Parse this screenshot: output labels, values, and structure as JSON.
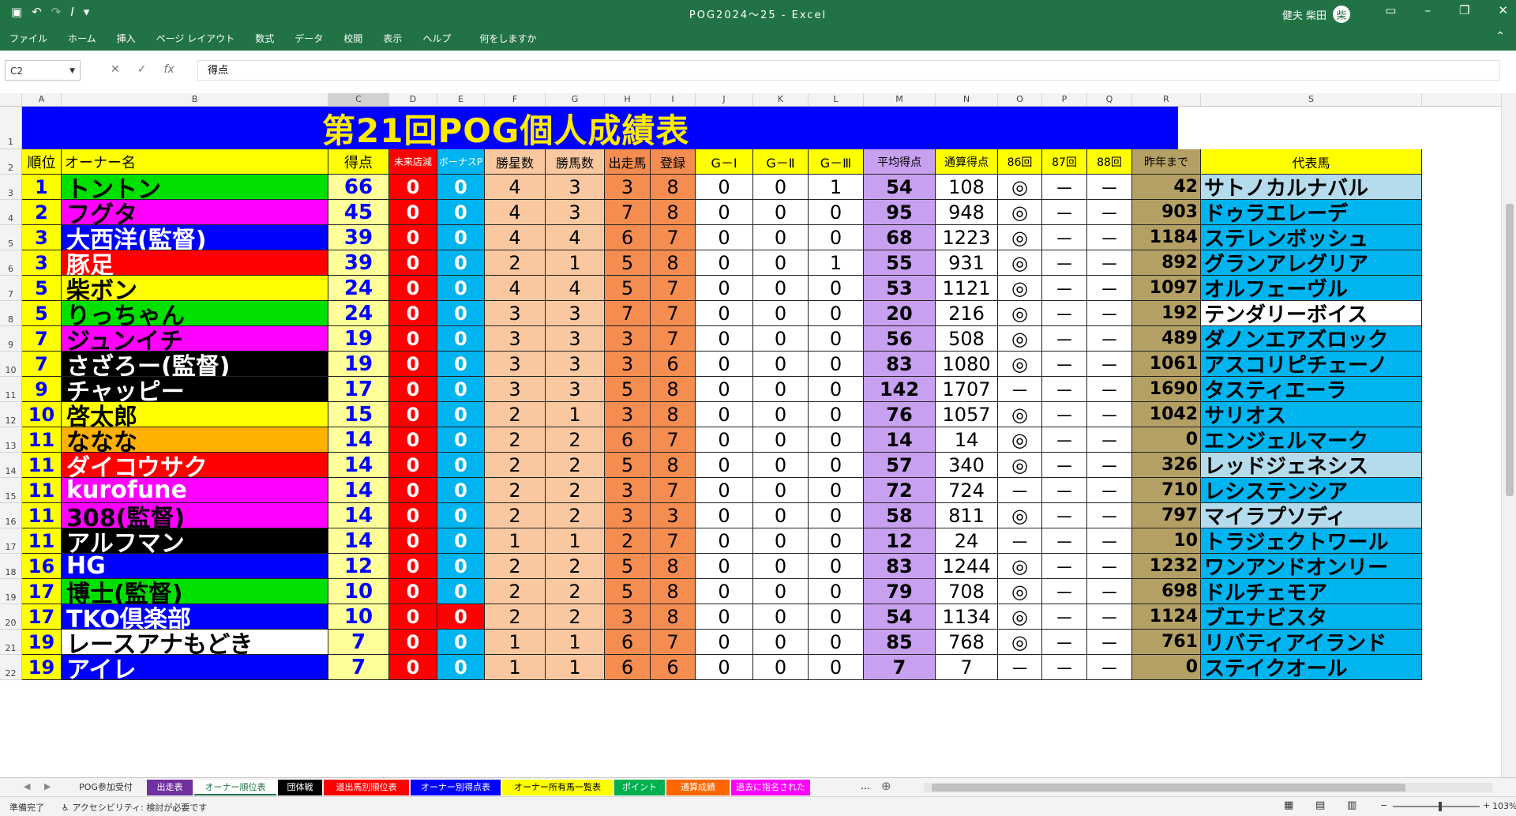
{
  "window": {
    "title": "POG2024～25 - Excel",
    "user": "健夫 柴田",
    "user_initial": "柴"
  },
  "qat": {
    "save_icon": "save-icon",
    "undo": "↶",
    "redo": "↷",
    "italic": "I"
  },
  "ribbon_tabs": [
    "ファイル",
    "ホーム",
    "挿入",
    "ページ レイアウト",
    "数式",
    "データ",
    "校閲",
    "表示",
    "ヘルプ",
    "何をしますか"
  ],
  "formula_bar": {
    "name_box": "C2",
    "formula": "得点"
  },
  "column_letters": [
    "A",
    "B",
    "C",
    "D",
    "E",
    "F",
    "G",
    "H",
    "I",
    "J",
    "K",
    "L",
    "M",
    "N",
    "O",
    "P",
    "Q",
    "R",
    "S"
  ],
  "sheet_title": "第21回POG個人成績表",
  "headers": [
    "順位",
    "オーナー名",
    "得点",
    "未来店減",
    "ボーナスP",
    "勝星数",
    "勝馬数",
    "出走馬",
    "登録",
    "G－Ⅰ",
    "G－Ⅱ",
    "G－Ⅲ",
    "平均得点",
    "通算得点",
    "86回",
    "87回",
    "88回",
    "昨年まで",
    "代表馬"
  ],
  "row_numbers": [
    "1",
    "2",
    "3",
    "4",
    "5",
    "6",
    "7",
    "8",
    "9",
    "10",
    "11",
    "12",
    "13",
    "14",
    "15",
    "16",
    "17",
    "18",
    "19",
    "20",
    "21",
    "22"
  ],
  "rows": [
    [
      "1",
      "トントン",
      "66",
      "0",
      "0",
      "4",
      "3",
      "3",
      "8",
      "0",
      "0",
      "1",
      "54",
      "108",
      "◎",
      "－",
      "－",
      "42",
      "サトノカルナバル"
    ],
    [
      "2",
      "フグタ",
      "45",
      "0",
      "0",
      "4",
      "3",
      "7",
      "8",
      "0",
      "0",
      "0",
      "95",
      "948",
      "◎",
      "－",
      "－",
      "903",
      "ドゥラエレーデ"
    ],
    [
      "3",
      "大西洋(監督)",
      "39",
      "0",
      "0",
      "4",
      "4",
      "6",
      "7",
      "0",
      "0",
      "0",
      "68",
      "1223",
      "◎",
      "－",
      "－",
      "1184",
      "ステレンボッシュ"
    ],
    [
      "3",
      "豚足",
      "39",
      "0",
      "0",
      "2",
      "1",
      "5",
      "8",
      "0",
      "0",
      "1",
      "55",
      "931",
      "◎",
      "－",
      "－",
      "892",
      "グランアレグリア"
    ],
    [
      "5",
      "柴ボン",
      "24",
      "0",
      "0",
      "4",
      "4",
      "5",
      "7",
      "0",
      "0",
      "0",
      "53",
      "1121",
      "◎",
      "－",
      "－",
      "1097",
      "オルフェーヴル"
    ],
    [
      "5",
      "りっちゃん",
      "24",
      "0",
      "0",
      "3",
      "3",
      "7",
      "7",
      "0",
      "0",
      "0",
      "20",
      "216",
      "◎",
      "－",
      "－",
      "192",
      "テンダリーボイス"
    ],
    [
      "7",
      "ジュンイチ",
      "19",
      "0",
      "0",
      "3",
      "3",
      "3",
      "7",
      "0",
      "0",
      "0",
      "56",
      "508",
      "◎",
      "－",
      "－",
      "489",
      "ダノンエアズロック"
    ],
    [
      "7",
      "さざろー(監督)",
      "19",
      "0",
      "0",
      "3",
      "3",
      "3",
      "6",
      "0",
      "0",
      "0",
      "83",
      "1080",
      "◎",
      "－",
      "－",
      "1061",
      "アスコリピチェーノ"
    ],
    [
      "9",
      "チャッピー",
      "17",
      "0",
      "0",
      "3",
      "3",
      "5",
      "8",
      "0",
      "0",
      "0",
      "142",
      "1707",
      "－",
      "－",
      "－",
      "1690",
      "タスティエーラ"
    ],
    [
      "10",
      "啓太郎",
      "15",
      "0",
      "0",
      "2",
      "1",
      "3",
      "8",
      "0",
      "0",
      "0",
      "76",
      "1057",
      "◎",
      "－",
      "－",
      "1042",
      "サリオス"
    ],
    [
      "11",
      "ななな",
      "14",
      "0",
      "0",
      "2",
      "2",
      "6",
      "7",
      "0",
      "0",
      "0",
      "14",
      "14",
      "◎",
      "－",
      "－",
      "0",
      "エンジェルマーク"
    ],
    [
      "11",
      "ダイコウサク",
      "14",
      "0",
      "0",
      "2",
      "2",
      "5",
      "8",
      "0",
      "0",
      "0",
      "57",
      "340",
      "◎",
      "－",
      "－",
      "326",
      "レッドジェネシス"
    ],
    [
      "11",
      "kurofune",
      "14",
      "0",
      "0",
      "2",
      "2",
      "3",
      "7",
      "0",
      "0",
      "0",
      "72",
      "724",
      "－",
      "－",
      "－",
      "710",
      "レシステンシア"
    ],
    [
      "11",
      "308(監督)",
      "14",
      "0",
      "0",
      "2",
      "2",
      "3",
      "3",
      "0",
      "0",
      "0",
      "58",
      "811",
      "◎",
      "－",
      "－",
      "797",
      "マイラプソディ"
    ],
    [
      "11",
      "アルフマン",
      "14",
      "0",
      "0",
      "1",
      "1",
      "2",
      "7",
      "0",
      "0",
      "0",
      "12",
      "24",
      "－",
      "－",
      "－",
      "10",
      "トラジェクトワール"
    ],
    [
      "16",
      "HG",
      "12",
      "0",
      "0",
      "2",
      "2",
      "5",
      "8",
      "0",
      "0",
      "0",
      "83",
      "1244",
      "◎",
      "－",
      "－",
      "1232",
      "ワンアンドオンリー"
    ],
    [
      "17",
      "博士(監督)",
      "10",
      "0",
      "0",
      "2",
      "2",
      "5",
      "8",
      "0",
      "0",
      "0",
      "79",
      "708",
      "◎",
      "－",
      "－",
      "698",
      "ドルチェモア"
    ],
    [
      "17",
      "TKO倶楽部",
      "10",
      "0",
      "0",
      "2",
      "2",
      "3",
      "8",
      "0",
      "0",
      "0",
      "54",
      "1134",
      "◎",
      "－",
      "－",
      "1124",
      "ブエナビスタ"
    ],
    [
      "19",
      "レースアナもどき",
      "7",
      "0",
      "0",
      "1",
      "1",
      "6",
      "7",
      "0",
      "0",
      "0",
      "85",
      "768",
      "◎",
      "－",
      "－",
      "761",
      "リバティアイランド"
    ],
    [
      "19",
      "アイレ",
      "7",
      "0",
      "0",
      "1",
      "1",
      "6",
      "6",
      "0",
      "0",
      "0",
      "7",
      "7",
      "－",
      "－",
      "－",
      "0",
      "ステイクオール"
    ]
  ],
  "owner_colors": [
    {
      "bg": "#00e000",
      "fg": "#000000"
    },
    {
      "bg": "#ff00ff",
      "fg": "#000000"
    },
    {
      "bg": "#0000ff",
      "fg": "#ffffff"
    },
    {
      "bg": "#ff0000",
      "fg": "#ffffff"
    },
    {
      "bg": "#ffff00",
      "fg": "#000000"
    },
    {
      "bg": "#00e000",
      "fg": "#000000"
    },
    {
      "bg": "#ff00ff",
      "fg": "#000000"
    },
    {
      "bg": "#000000",
      "fg": "#ffffff"
    },
    {
      "bg": "#000000",
      "fg": "#ffffff"
    },
    {
      "bg": "#ffff00",
      "fg": "#000000"
    },
    {
      "bg": "#ffb000",
      "fg": "#000000"
    },
    {
      "bg": "#ff0000",
      "fg": "#ffffff"
    },
    {
      "bg": "#ff00ff",
      "fg": "#ffffff"
    },
    {
      "bg": "#ff00ff",
      "fg": "#000000"
    },
    {
      "bg": "#000000",
      "fg": "#ffffff"
    },
    {
      "bg": "#0000ff",
      "fg": "#ffffff"
    },
    {
      "bg": "#00e000",
      "fg": "#000000"
    },
    {
      "bg": "#0000ff",
      "fg": "#ffffff"
    },
    {
      "bg": "#ffffff",
      "fg": "#000000"
    },
    {
      "bg": "#0000ff",
      "fg": "#ffffff"
    }
  ],
  "horse_colors": [
    "#b4dcec",
    "#00b4f0",
    "#00b4f0",
    "#00b4f0",
    "#00b4f0",
    "#ffffff",
    "#00b4f0",
    "#00b4f0",
    "#00b4f0",
    "#00b4f0",
    "#00b4f0",
    "#b4dcec",
    "#00b4f0",
    "#b4dcec",
    "#00b4f0",
    "#00b4f0",
    "#00b4f0",
    "#00b4f0",
    "#00b4f0",
    "#00b4f0"
  ],
  "sheet_tabs": [
    {
      "label": "POG参加受付",
      "bg": "#f3f3f3",
      "fg": "#333333"
    },
    {
      "label": "出走表",
      "bg": "#7030a0",
      "fg": "#ffffff"
    },
    {
      "label": "オーナー順位表",
      "bg": "#ffffff",
      "fg": "#217346"
    },
    {
      "label": "団体戦",
      "bg": "#000000",
      "fg": "#ffffff"
    },
    {
      "label": "道出馬別順位表",
      "bg": "#ff0000",
      "fg": "#ffffff"
    },
    {
      "label": "オーナー別得点表",
      "bg": "#0000ff",
      "fg": "#ffffff"
    },
    {
      "label": "オーナー所有馬一覧表",
      "bg": "#ffff00",
      "fg": "#000000"
    },
    {
      "label": "ポイント",
      "bg": "#00b050",
      "fg": "#ffffff"
    },
    {
      "label": "通算成績",
      "bg": "#ff6600",
      "fg": "#ffffff"
    },
    {
      "label": "過去に指名された",
      "bg": "#ff00ff",
      "fg": "#ffffff"
    }
  ],
  "status": {
    "ready": "準備完了",
    "accessibility": "アクセシビリティ: 検討が必要です",
    "zoom": "103%"
  }
}
